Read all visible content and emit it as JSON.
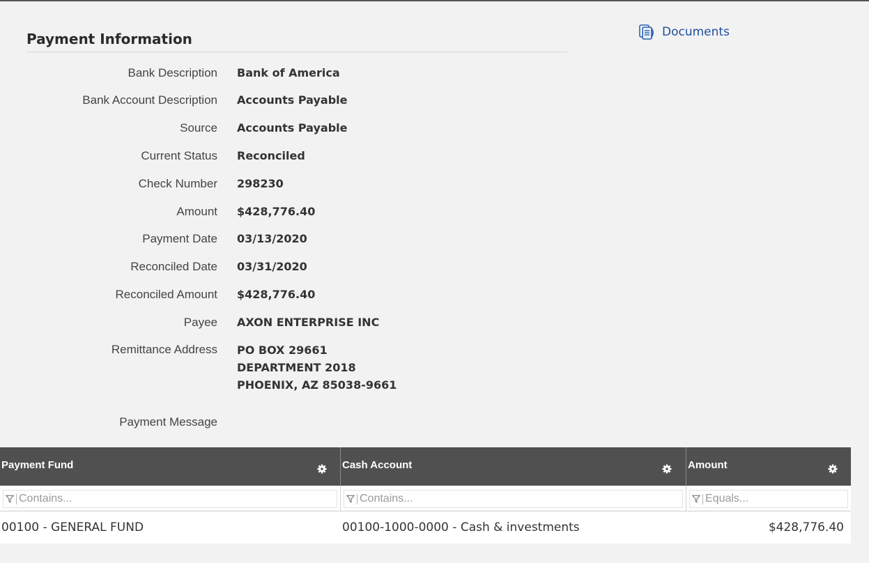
{
  "section": {
    "title": "Payment Information"
  },
  "documents": {
    "label": "Documents",
    "icon": "documents-icon"
  },
  "fields": [
    {
      "label": "Bank Description",
      "value": "Bank of America"
    },
    {
      "label": "Bank Account Description",
      "value": "Accounts Payable"
    },
    {
      "label": "Source",
      "value": "Accounts Payable"
    },
    {
      "label": "Current Status",
      "value": "Reconciled"
    },
    {
      "label": "Check Number",
      "value": "298230"
    },
    {
      "label": "Amount",
      "value": "$428,776.40"
    },
    {
      "label": "Payment Date",
      "value": "03/13/2020"
    },
    {
      "label": "Reconciled Date",
      "value": "03/31/2020"
    },
    {
      "label": "Reconciled Amount",
      "value": "$428,776.40"
    },
    {
      "label": "Payee",
      "value": "AXON ENTERPRISE INC"
    }
  ],
  "remittance": {
    "label": "Remittance Address",
    "lines": [
      "PO BOX 29661",
      "DEPARTMENT 2018",
      "PHOENIX, AZ 85038-9661"
    ]
  },
  "payment_message": {
    "label": "Payment Message",
    "value": ""
  },
  "grid": {
    "columns": [
      {
        "label": "Payment Fund",
        "filter_placeholder": "Contains..."
      },
      {
        "label": "Cash Account",
        "filter_placeholder": "Contains..."
      },
      {
        "label": "Amount",
        "filter_placeholder": "Equals..."
      }
    ],
    "rows": [
      {
        "payment_fund": "00100 - GENERAL FUND",
        "cash_account": "00100-1000-0000 - Cash & investments",
        "amount": "$428,776.40"
      }
    ]
  },
  "colors": {
    "header_bg": "#505050",
    "page_bg": "#f2f2f2",
    "link": "#1f4fa0"
  }
}
